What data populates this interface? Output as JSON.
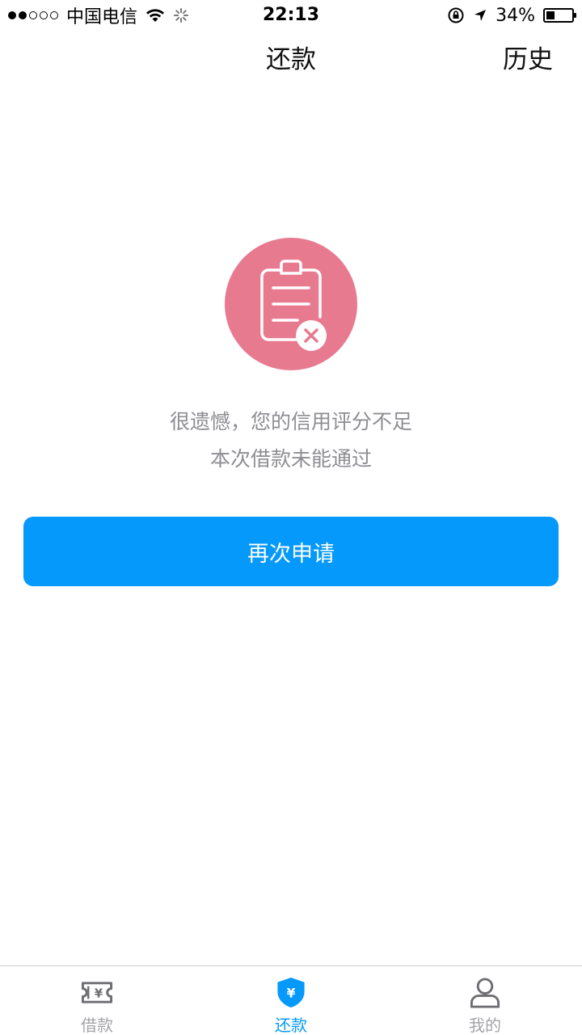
{
  "status_bar": {
    "carrier": "中国电信",
    "time": "22:13",
    "battery_text": "34%",
    "battery_level": 0.34
  },
  "nav": {
    "title": "还款",
    "history_label": "历史"
  },
  "result": {
    "line1": "很遗憾，您的信用评分不足",
    "line2": "本次借款未能通过",
    "icon": "clipboard-rejected-icon",
    "icon_color": "#e87a90"
  },
  "apply_button": {
    "label": "再次申请",
    "color": "#0599fb"
  },
  "tab_bar": {
    "tabs": [
      {
        "label": "借款",
        "icon": "loan-ticket-icon",
        "active": false
      },
      {
        "label": "还款",
        "icon": "repay-shield-icon",
        "active": true
      },
      {
        "label": "我的",
        "icon": "user-icon",
        "active": false
      }
    ]
  },
  "colors": {
    "accent": "#0599fb",
    "inactive": "#a4a4a8",
    "message": "#8e8e93"
  }
}
